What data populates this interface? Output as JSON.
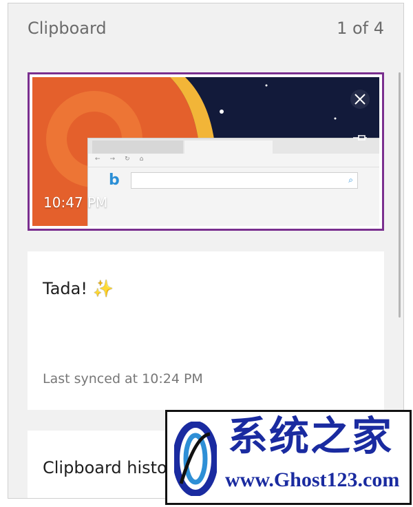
{
  "header": {
    "title": "Clipboard",
    "page_indicator": "1 of 4"
  },
  "items": [
    {
      "type": "image",
      "time": "10:47 PM",
      "selected": true,
      "border_color": "#7a2f8f",
      "actions": [
        "close-icon",
        "pin-icon"
      ]
    },
    {
      "type": "text",
      "text": "Tada!",
      "emoji": "✨",
      "sync_status": "Last synced at 10:24 PM"
    },
    {
      "type": "text",
      "text": "Clipboard histo"
    }
  ],
  "watermark": {
    "title": "系统之家",
    "url": "www.Ghost123.com",
    "color": "#1a2ba0"
  },
  "colors": {
    "panel_bg": "#f1f1f1",
    "item_bg": "#ffffff",
    "selection": "#7a2f8f"
  }
}
